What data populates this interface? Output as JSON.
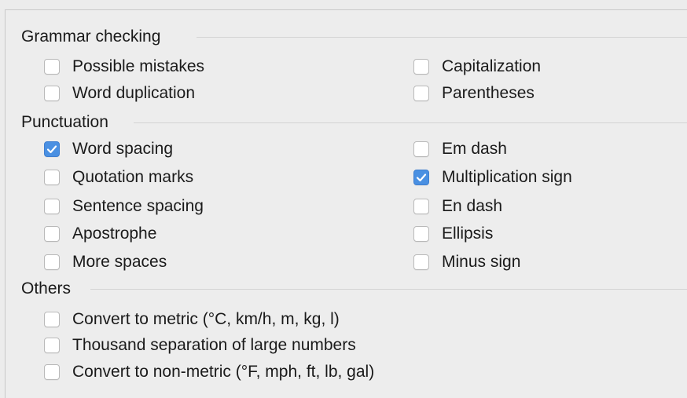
{
  "sections": {
    "grammar": {
      "title": "Grammar checking",
      "options": [
        {
          "label": "Possible mistakes",
          "checked": false
        },
        {
          "label": "Capitalization",
          "checked": false
        },
        {
          "label": "Word duplication",
          "checked": false
        },
        {
          "label": "Parentheses",
          "checked": false
        }
      ]
    },
    "punctuation": {
      "title": "Punctuation",
      "options": [
        {
          "label": "Word spacing",
          "checked": true
        },
        {
          "label": "Em dash",
          "checked": false
        },
        {
          "label": "Quotation marks",
          "checked": false
        },
        {
          "label": "Multiplication sign",
          "checked": true
        },
        {
          "label": "Sentence spacing",
          "checked": false
        },
        {
          "label": "En dash",
          "checked": false
        },
        {
          "label": "Apostrophe",
          "checked": false
        },
        {
          "label": "Ellipsis",
          "checked": false
        },
        {
          "label": "More spaces",
          "checked": false
        },
        {
          "label": "Minus sign",
          "checked": false
        }
      ]
    },
    "others": {
      "title": "Others",
      "options": [
        {
          "label": "Convert to metric (°C, km/h, m, kg, l)",
          "checked": false
        },
        {
          "label": "Thousand separation of large numbers",
          "checked": false
        },
        {
          "label": "Convert to non-metric (°F, mph, ft, lb, gal)",
          "checked": false
        }
      ]
    }
  },
  "colors": {
    "checked": "#4a90e2",
    "background": "#ececec",
    "separator": "#d4d4d4"
  },
  "icons": {
    "check": "checkmark-icon"
  }
}
